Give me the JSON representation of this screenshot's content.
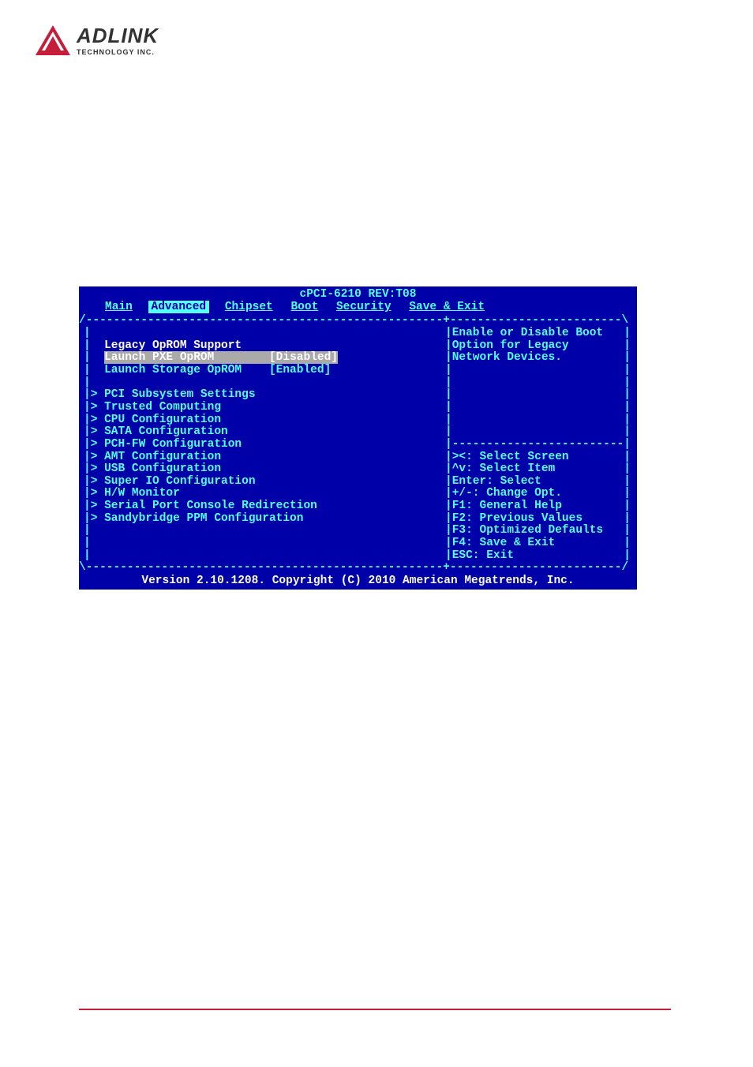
{
  "logo": {
    "name": "ADLINK",
    "subtitle": "TECHNOLOGY INC."
  },
  "bios": {
    "title": "cPCI-6210 REV:T08",
    "tabs": {
      "main": "Main",
      "advanced": "Advanced",
      "chipset": "Chipset",
      "boot": "Boot",
      "security": "Security",
      "save_exit": "Save & Exit"
    },
    "section_header": "Legacy OpROM Support",
    "settings": {
      "pxe_oprom": {
        "label": "Launch PXE OpROM",
        "value": "[Disabled]"
      },
      "storage_oprom": {
        "label": "Launch Storage OpROM",
        "value": "[Enabled]"
      }
    },
    "submenus": [
      "PCI Subsystem Settings",
      "Trusted Computing",
      "CPU Configuration",
      "SATA Configuration",
      "PCH-FW Configuration",
      "AMT Configuration",
      "USB Configuration",
      "Super IO Configuration",
      "H/W Monitor",
      "Serial Port Console Redirection",
      "Sandybridge PPM Configuration"
    ],
    "help_text": [
      "Enable or Disable Boot",
      "Option for Legacy",
      "Network Devices."
    ],
    "key_help": [
      "><: Select Screen",
      "^v: Select Item",
      "Enter: Select",
      "+/-: Change Opt.",
      "F1: General Help",
      "F2: Previous Values",
      "F3: Optimized Defaults",
      "F4: Save & Exit",
      "ESC: Exit"
    ],
    "footer": "Version 2.10.1208. Copyright (C) 2010 American Megatrends, Inc."
  }
}
